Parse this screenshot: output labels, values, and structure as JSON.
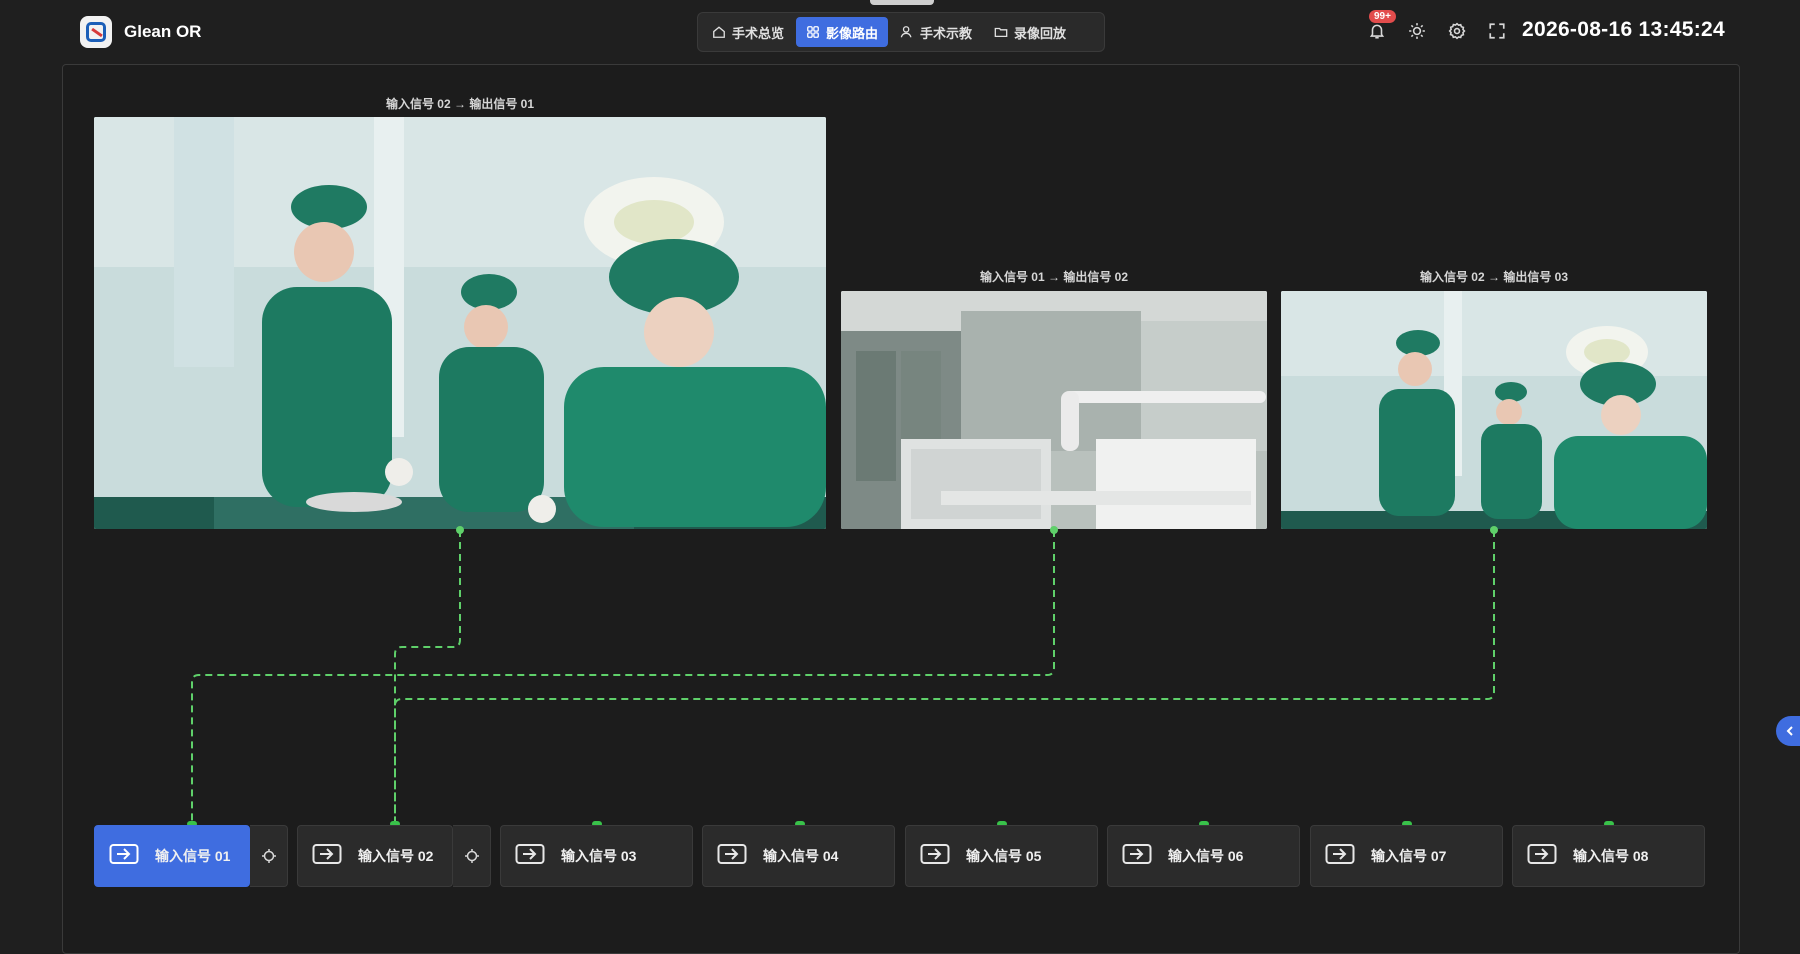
{
  "header": {
    "app_title": "Glean OR",
    "nav": [
      {
        "label": "手术总览",
        "icon": "home-icon"
      },
      {
        "label": "影像路由",
        "icon": "grid-icon",
        "active": true
      },
      {
        "label": "手术示教",
        "icon": "user-icon"
      },
      {
        "label": "录像回放",
        "icon": "folder-icon"
      }
    ],
    "notification_badge": "99+",
    "datetime": "2026-08-16 13:45:24"
  },
  "outputs": [
    {
      "label": "输入信号 02 → 输出信号 01"
    },
    {
      "label": "输入信号 01 → 输出信号 02"
    },
    {
      "label": "输入信号 02 → 输出信号 03"
    }
  ],
  "inputs": [
    {
      "label": "输入信号 01",
      "active": true
    },
    {
      "label": "输入信号 02"
    },
    {
      "label": "输入信号 03"
    },
    {
      "label": "输入信号 04"
    },
    {
      "label": "输入信号 05"
    },
    {
      "label": "输入信号 06"
    },
    {
      "label": "输入信号 07"
    },
    {
      "label": "输入信号 08"
    }
  ],
  "colors": {
    "accent": "#3f6de0",
    "wire": "#5fd06a",
    "badge": "#e24c4c"
  }
}
